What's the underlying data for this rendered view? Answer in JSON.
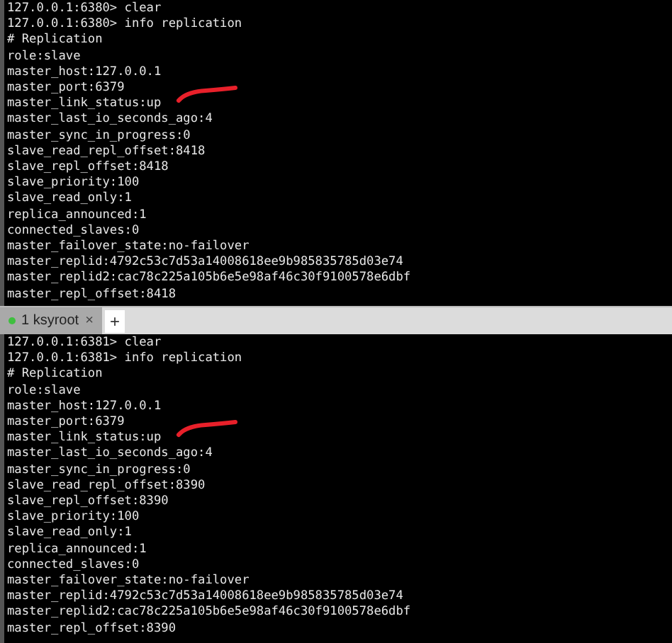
{
  "panes": [
    {
      "lines": [
        {
          "text": "127.0.0.1:6380> clear",
          "annotated": false
        },
        {
          "text": "127.0.0.1:6380> info replication",
          "annotated": false
        },
        {
          "text": "# Replication",
          "annotated": false
        },
        {
          "text": "role:slave",
          "annotated": false
        },
        {
          "text": "master_host:127.0.0.1",
          "annotated": false
        },
        {
          "text": "master_port:6379",
          "annotated": false
        },
        {
          "text": "master_link_status:up",
          "annotated": true
        },
        {
          "text": "master_last_io_seconds_ago:4",
          "annotated": false
        },
        {
          "text": "master_sync_in_progress:0",
          "annotated": false
        },
        {
          "text": "slave_read_repl_offset:8418",
          "annotated": false
        },
        {
          "text": "slave_repl_offset:8418",
          "annotated": false
        },
        {
          "text": "slave_priority:100",
          "annotated": false
        },
        {
          "text": "slave_read_only:1",
          "annotated": false
        },
        {
          "text": "replica_announced:1",
          "annotated": false
        },
        {
          "text": "connected_slaves:0",
          "annotated": false
        },
        {
          "text": "master_failover_state:no-failover",
          "annotated": false
        },
        {
          "text": "master_replid:4792c53c7d53a14008618ee9b985835785d03e74",
          "annotated": false
        },
        {
          "text": "master_replid2:cac78c225a105b6e5e98af46c30f9100578e6dbf",
          "annotated": false
        },
        {
          "text": "master_repl_offset:8418",
          "annotated": false
        }
      ]
    },
    {
      "lines": [
        {
          "text": "127.0.0.1:6381> clear",
          "annotated": false
        },
        {
          "text": "127.0.0.1:6381> info replication",
          "annotated": false
        },
        {
          "text": "# Replication",
          "annotated": false
        },
        {
          "text": "role:slave",
          "annotated": false
        },
        {
          "text": "master_host:127.0.0.1",
          "annotated": false
        },
        {
          "text": "master_port:6379",
          "annotated": false
        },
        {
          "text": "master_link_status:up",
          "annotated": true
        },
        {
          "text": "master_last_io_seconds_ago:4",
          "annotated": false
        },
        {
          "text": "master_sync_in_progress:0",
          "annotated": false
        },
        {
          "text": "slave_read_repl_offset:8390",
          "annotated": false
        },
        {
          "text": "slave_repl_offset:8390",
          "annotated": false
        },
        {
          "text": "slave_priority:100",
          "annotated": false
        },
        {
          "text": "slave_read_only:1",
          "annotated": false
        },
        {
          "text": "replica_announced:1",
          "annotated": false
        },
        {
          "text": "connected_slaves:0",
          "annotated": false
        },
        {
          "text": "master_failover_state:no-failover",
          "annotated": false
        },
        {
          "text": "master_replid:4792c53c7d53a14008618ee9b985835785d03e74",
          "annotated": false
        },
        {
          "text": "master_replid2:cac78c225a105b6e5e98af46c30f9100578e6dbf",
          "annotated": false
        },
        {
          "text": "master_repl_offset:8390",
          "annotated": false
        }
      ]
    }
  ],
  "tab_bar": {
    "tabs": [
      {
        "label": "1 ksyroot",
        "close": "×",
        "selected": true
      }
    ],
    "new_tab": "+"
  }
}
